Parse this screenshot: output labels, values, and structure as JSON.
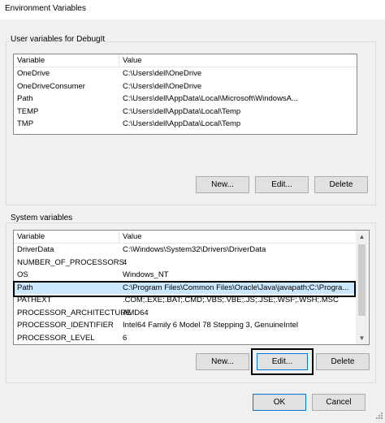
{
  "window": {
    "title": "Environment Variables"
  },
  "user_vars": {
    "group_label": "User variables for DebugIt",
    "columns": {
      "variable": "Variable",
      "value": "Value"
    },
    "rows": [
      {
        "variable": "OneDrive",
        "value": "C:\\Users\\dell\\OneDrive"
      },
      {
        "variable": "OneDriveConsumer",
        "value": "C:\\Users\\dell\\OneDrive"
      },
      {
        "variable": "Path",
        "value": "C:\\Users\\dell\\AppData\\Local\\Microsoft\\WindowsA..."
      },
      {
        "variable": "TEMP",
        "value": "C:\\Users\\dell\\AppData\\Local\\Temp"
      },
      {
        "variable": "TMP",
        "value": "C:\\Users\\dell\\AppData\\Local\\Temp"
      }
    ],
    "buttons": {
      "new": "New...",
      "edit": "Edit...",
      "delete": "Delete"
    }
  },
  "system_vars": {
    "group_label": "System variables",
    "columns": {
      "variable": "Variable",
      "value": "Value"
    },
    "rows": [
      {
        "variable": "DriverData",
        "value": "C:\\Windows\\System32\\Drivers\\DriverData"
      },
      {
        "variable": "NUMBER_OF_PROCESSORS",
        "value": "4"
      },
      {
        "variable": "OS",
        "value": "Windows_NT"
      },
      {
        "variable": "Path",
        "value": "C:\\Program Files\\Common Files\\Oracle\\Java\\javapath;C:\\Progra..."
      },
      {
        "variable": "PATHEXT",
        "value": ".COM;.EXE;.BAT;.CMD;.VBS;.VBE;.JS;.JSE;.WSF;.WSH;.MSC"
      },
      {
        "variable": "PROCESSOR_ARCHITECTURE",
        "value": "AMD64"
      },
      {
        "variable": "PROCESSOR_IDENTIFIER",
        "value": "Intel64 Family 6 Model 78 Stepping 3, GenuineIntel"
      },
      {
        "variable": "PROCESSOR_LEVEL",
        "value": "6"
      }
    ],
    "selected_index": 3,
    "buttons": {
      "new": "New...",
      "edit": "Edit...",
      "delete": "Delete"
    }
  },
  "footer": {
    "ok": "OK",
    "cancel": "Cancel"
  },
  "colors": {
    "selection": "#cce8ff",
    "accent": "#0078d7",
    "highlight": "#000000"
  },
  "icons": {
    "scroll_up": "▲",
    "scroll_down": "▼"
  }
}
